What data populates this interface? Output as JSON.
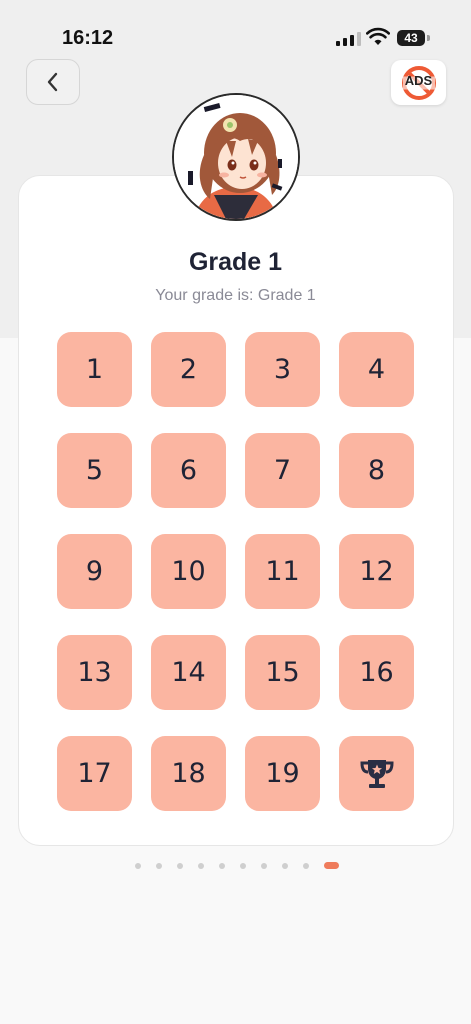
{
  "status_bar": {
    "time": "16:12",
    "battery": "43"
  },
  "header": {
    "ads_label": "ADS"
  },
  "grade": {
    "title": "Grade 1",
    "subtitle": "Your grade is: Grade 1"
  },
  "levels": [
    "1",
    "2",
    "3",
    "4",
    "5",
    "6",
    "7",
    "8",
    "9",
    "10",
    "11",
    "12",
    "13",
    "14",
    "15",
    "16",
    "17",
    "18",
    "19"
  ],
  "trophy_icon": "trophy-icon",
  "pagination": {
    "total_pages": 10,
    "active_index": 9
  },
  "colors": {
    "tile": "#fbb5a1",
    "accent": "#ef7c5c",
    "text": "#1f2335"
  }
}
